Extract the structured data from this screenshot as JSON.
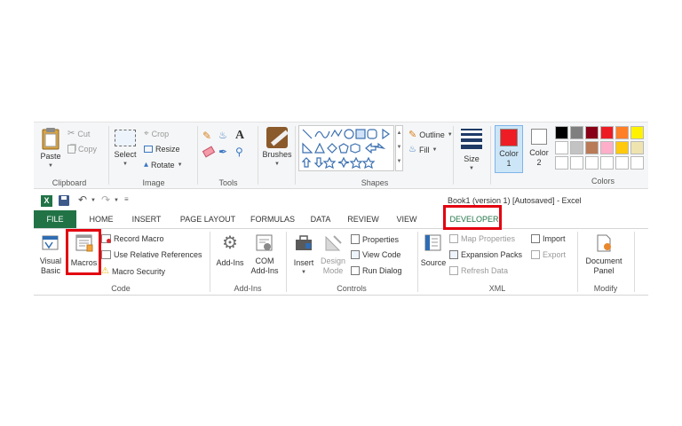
{
  "paint": {
    "clipboard": {
      "label": "Clipboard",
      "paste": "Paste",
      "cut": "Cut",
      "copy": "Copy"
    },
    "image": {
      "label": "Image",
      "select": "Select",
      "crop": "Crop",
      "resize": "Resize",
      "rotate": "Rotate"
    },
    "tools": {
      "label": "Tools",
      "text_tool": "A"
    },
    "brushes": {
      "label": "Brushes"
    },
    "shapes": {
      "label": "Shapes",
      "outline": "Outline",
      "fill": "Fill"
    },
    "size": {
      "label": "Size"
    },
    "color1": {
      "label_line1": "Color",
      "label_line2": "1",
      "value": "#ee1c24"
    },
    "color2": {
      "label_line1": "Color",
      "label_line2": "2",
      "value": "#ffffff"
    },
    "colors": {
      "label": "Colors",
      "palette_row1": [
        "#000000",
        "#7f7f7f",
        "#880015",
        "#ed1c24",
        "#ff7f27",
        "#fff200"
      ],
      "palette_row2": [
        "#ffffff",
        "#c3c3c3",
        "#b97a57",
        "#ffaec9",
        "#ffc90e",
        "#efe4b0"
      ],
      "palette_row3": [
        "#ffffff",
        "#ffffff",
        "#ffffff",
        "#ffffff",
        "#ffffff",
        "#ffffff"
      ]
    }
  },
  "excel": {
    "title": "Book1 (version 1) [Autosaved] - Excel",
    "tabs": [
      "FILE",
      "HOME",
      "INSERT",
      "PAGE LAYOUT",
      "FORMULAS",
      "DATA",
      "REVIEW",
      "VIEW",
      "DEVELOPER"
    ],
    "code": {
      "label": "Code",
      "visual_basic_line1": "Visual",
      "visual_basic_line2": "Basic",
      "macros": "Macros",
      "record_macro": "Record Macro",
      "relative_refs": "Use Relative References",
      "macro_security": "Macro Security"
    },
    "addins": {
      "label": "Add-Ins",
      "addins_btn": "Add-Ins",
      "com_line1": "COM",
      "com_line2": "Add-Ins"
    },
    "controls": {
      "label": "Controls",
      "insert": "Insert",
      "design_line1": "Design",
      "design_line2": "Mode",
      "properties": "Properties",
      "view_code": "View Code",
      "run_dialog": "Run Dialog"
    },
    "xml": {
      "label": "XML",
      "source": "Source",
      "map_properties": "Map Properties",
      "expansion_packs": "Expansion Packs",
      "refresh_data": "Refresh Data",
      "import": "Import",
      "export": "Export"
    },
    "modify": {
      "label": "Modify",
      "doc_line1": "Document",
      "doc_line2": "Panel"
    }
  }
}
